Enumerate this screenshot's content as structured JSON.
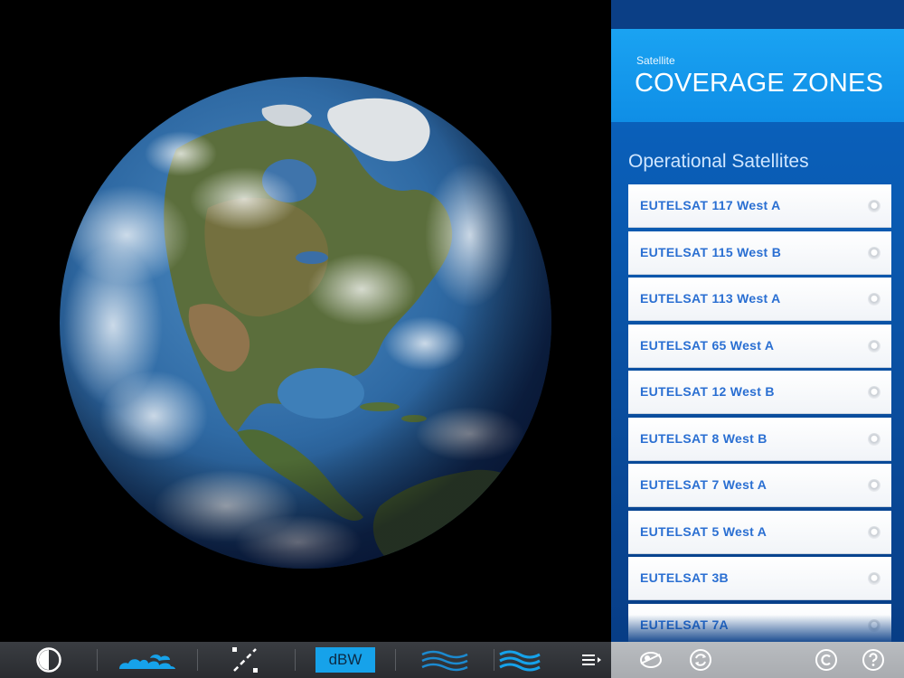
{
  "panel": {
    "kicker": "Satellite",
    "title": "COVERAGE ZONES",
    "section_title": "Operational Satellites",
    "satellites": [
      {
        "label": "EUTELSAT 117 West A"
      },
      {
        "label": "EUTELSAT 115 West B"
      },
      {
        "label": "EUTELSAT 113 West A"
      },
      {
        "label": "EUTELSAT 65 West A"
      },
      {
        "label": "EUTELSAT 12 West B"
      },
      {
        "label": "EUTELSAT 8 West B"
      },
      {
        "label": "EUTELSAT 7 West A"
      },
      {
        "label": "EUTELSAT 5 West A"
      },
      {
        "label": "EUTELSAT 3B"
      },
      {
        "label": "EUTELSAT 7A"
      }
    ]
  },
  "toolbar": {
    "icons": [
      "contrast-icon",
      "clouds-icon",
      "diagonal-line-icon",
      "waves-icon",
      "waves-active-icon",
      "menu-icon"
    ],
    "dbw_label": "dBW",
    "right_icons": [
      "satellite-icon",
      "refresh-icon",
      "copyright-icon",
      "help-icon"
    ]
  },
  "colors": {
    "accent": "#16a2ea",
    "header_band": "#1aa3f2",
    "panel_blue": "#0a5cb4",
    "satellite_label": "#2a6fd2",
    "toolbar_dark": "#2f3236",
    "toolbar_light": "#b1b4b8"
  }
}
